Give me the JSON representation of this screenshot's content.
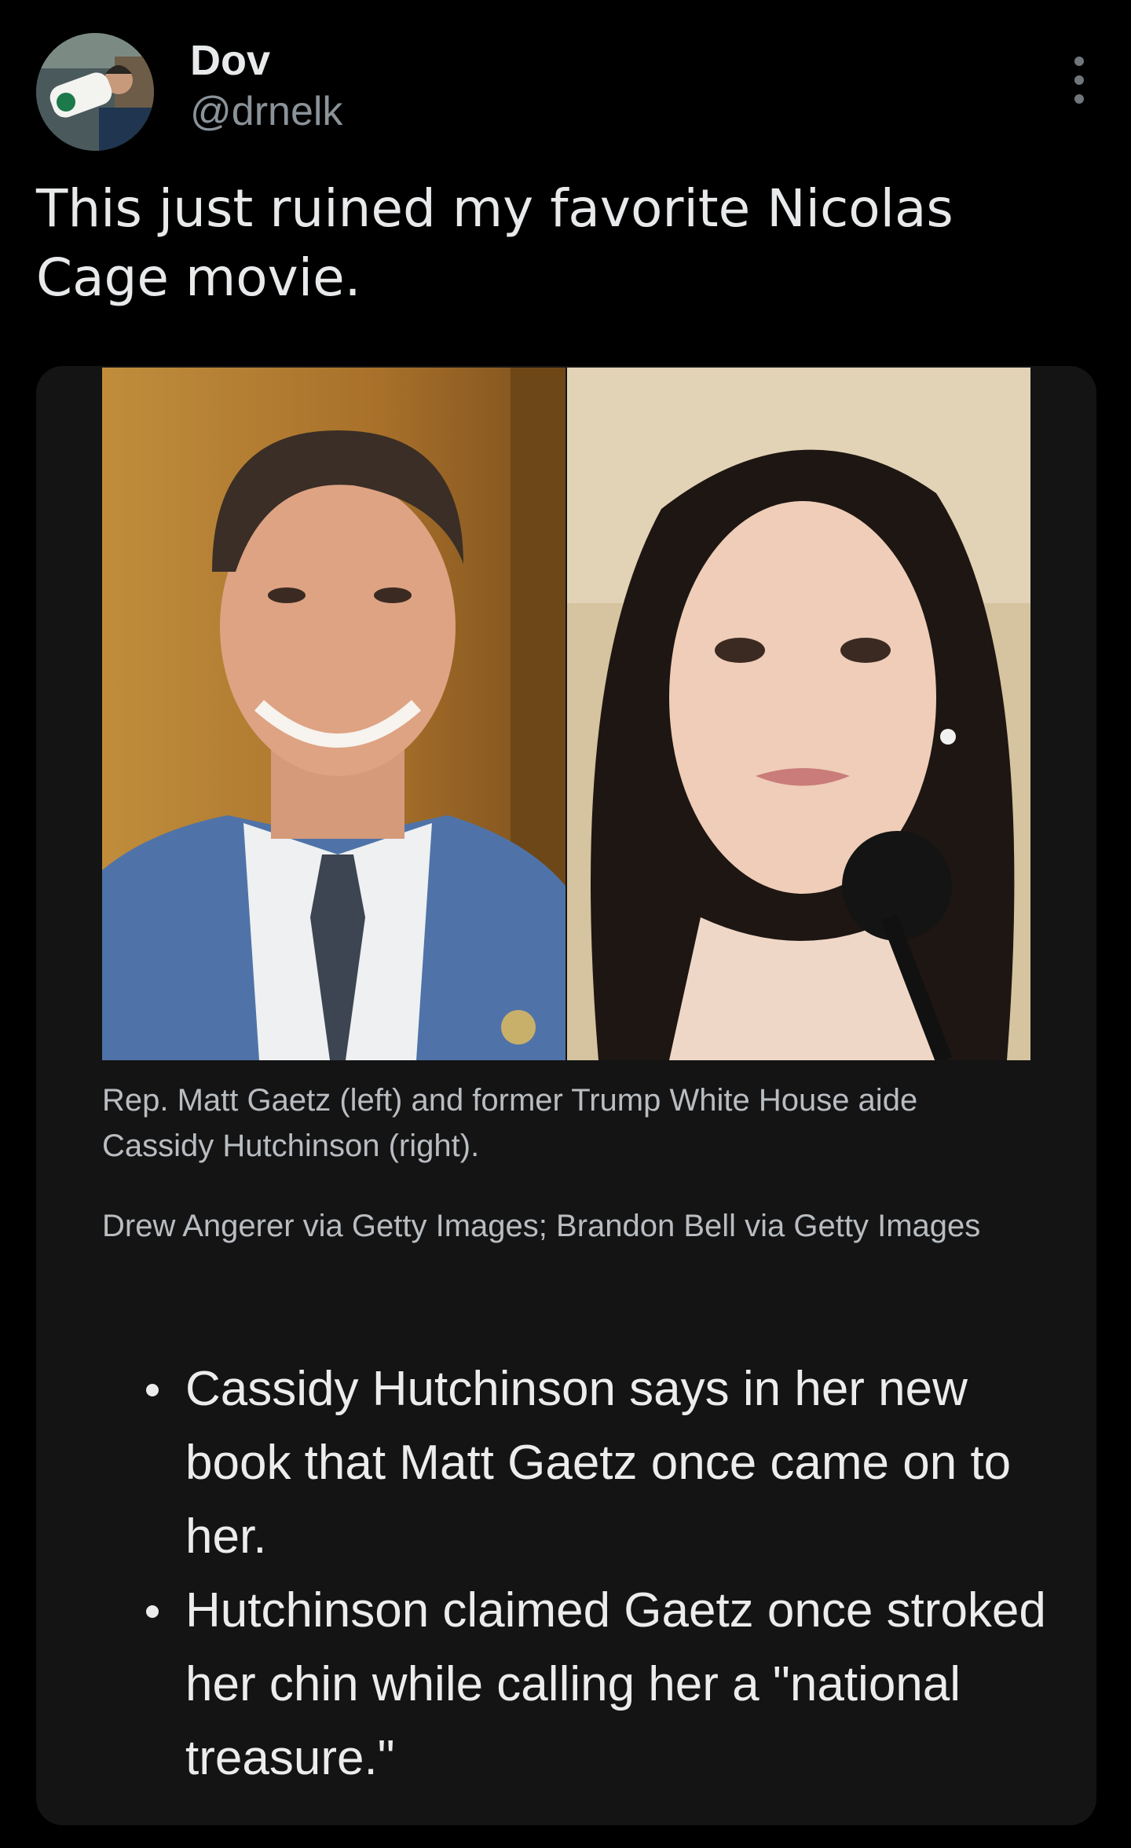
{
  "author": {
    "name": "Dov",
    "handle": "@drnelk"
  },
  "tweet": {
    "text": "This just ruined my favorite Nicolas Cage movie."
  },
  "article_card": {
    "caption": "Rep. Matt Gaetz (left) and former Trump White House aide Cassidy Hutchinson (right).",
    "credit": "Drew Angerer via Getty Images; Brandon Bell via Getty Images",
    "bullets": [
      "Cassidy Hutchinson says in her new book that Matt Gaetz once came on to her.",
      "Hutchinson claimed Gaetz once stroked her chin while calling her a \"national treasure.\""
    ]
  },
  "icons": {
    "more": "more-vertical-icon"
  }
}
